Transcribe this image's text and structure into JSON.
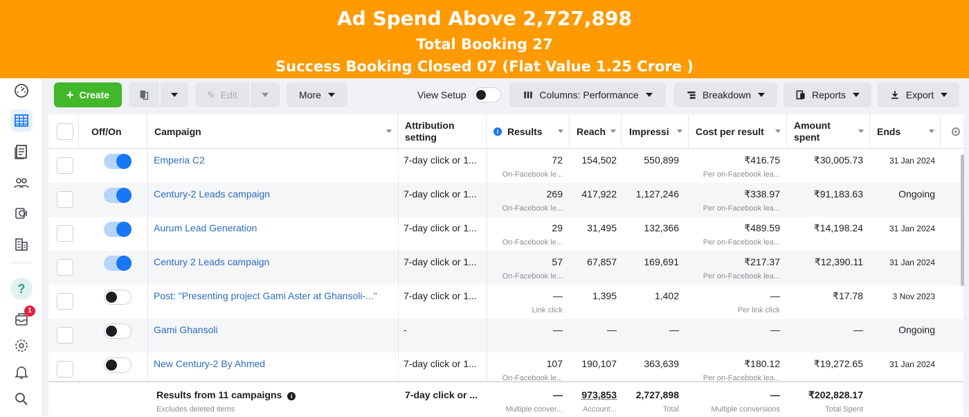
{
  "banner": {
    "line1": "Ad Spend Above 2,727,898",
    "line2": "Total Booking 27",
    "line3": "Success Booking Closed 07  (Flat Value 1.25 Crore )"
  },
  "rail": {
    "icons": [
      "dashboard-gauge-icon",
      "campaigns-table-icon",
      "pages-icon",
      "audiences-icon",
      "billing-icon",
      "catalog-icon",
      "help-icon",
      "notifications-inbox-icon",
      "settings-gear-icon",
      "alerts-bell-icon",
      "search-icon"
    ],
    "inbox_badge": "1"
  },
  "toolbar": {
    "create_label": "Create",
    "edit_label": "Edit",
    "more_label": "More",
    "view_setup_label": "View Setup",
    "columns_label": "Columns: Performance",
    "breakdown_label": "Breakdown",
    "reports_label": "Reports",
    "export_label": "Export"
  },
  "table": {
    "headers": {
      "offon": "Off/On",
      "campaign": "Campaign",
      "attribution_1": "Attribution",
      "attribution_2": "setting",
      "results": "Results",
      "reach": "Reach",
      "impressions": "Impressi",
      "cost": "Cost per result",
      "amount_1": "Amount",
      "amount_2": "spent",
      "ends": "Ends"
    },
    "rows": [
      {
        "on": true,
        "campaign": "Emperia C2",
        "attribution": "7-day click or 1...",
        "results": "72",
        "results_sub": "On-Facebook le...",
        "reach": "154,502",
        "impressions": "550,899",
        "cost": "₹416.75",
        "cost_sub": "Per on-Facebook lea...",
        "amount": "₹30,005.73",
        "ends": "31 Jan 2024"
      },
      {
        "on": true,
        "campaign": "Century-2 Leads campaign",
        "attribution": "7-day click or 1...",
        "results": "269",
        "results_sub": "On-Facebook le...",
        "reach": "417,922",
        "impressions": "1,127,246",
        "cost": "₹338.97",
        "cost_sub": "Per on-Facebook lea...",
        "amount": "₹91,183.63",
        "ends": "Ongoing"
      },
      {
        "on": true,
        "campaign": "Aurum Lead Generation",
        "attribution": "7-day click or 1...",
        "results": "29",
        "results_sub": "On-Facebook le...",
        "reach": "31,495",
        "impressions": "132,366",
        "cost": "₹489.59",
        "cost_sub": "Per on-Facebook lea...",
        "amount": "₹14,198.24",
        "ends": "31 Jan 2024"
      },
      {
        "on": true,
        "campaign": "Century 2 Leads campaign",
        "attribution": "7-day click or 1...",
        "results": "57",
        "results_sub": "On-Facebook le...",
        "reach": "67,857",
        "impressions": "169,691",
        "cost": "₹217.37",
        "cost_sub": "Per on-Facebook lea...",
        "amount": "₹12,390.11",
        "ends": "31 Jan 2024"
      },
      {
        "on": false,
        "campaign": "Post: \"Presenting project Gami Aster at Ghansoli-...\"",
        "attribution": "7-day click or 1...",
        "results": "—",
        "results_sub": "Link click",
        "reach": "1,395",
        "impressions": "1,402",
        "cost": "—",
        "cost_sub": "Per link click",
        "amount": "₹17.78",
        "ends": "3 Nov 2023"
      },
      {
        "on": false,
        "campaign": "Gami Ghansoli",
        "attribution": "-",
        "results": "—",
        "results_sub": "",
        "reach": "—",
        "impressions": "—",
        "cost": "—",
        "cost_sub": "",
        "amount": "—",
        "ends": "Ongoing"
      },
      {
        "on": false,
        "campaign": "New Century-2 By Ahmed",
        "attribution": "7-day click or 1...",
        "results": "107",
        "results_sub": "On-Facebook le...",
        "reach": "190,107",
        "impressions": "363,639",
        "cost": "₹180.12",
        "cost_sub": "Per on-Facebook lea...",
        "amount": "₹19,272.65",
        "ends": "31 Jan 2024"
      }
    ],
    "footer": {
      "label": "Results from 11 campaigns",
      "label_sub": "Excludes deleted items",
      "attribution": "7-day click or ...",
      "results": "—",
      "results_sub": "Multiple conver...",
      "reach": "973,853",
      "reach_sub": "Account...",
      "impressions": "2,727,898",
      "impressions_sub": "Total",
      "cost": "—",
      "cost_sub": "Multiple conversions",
      "amount": "₹202,828.17",
      "amount_sub": "Total Spent"
    }
  },
  "colors": {
    "banner": "#ff9a00",
    "create": "#42b72a",
    "link": "#2d6cc0",
    "toggle_on": "#1877f2"
  }
}
